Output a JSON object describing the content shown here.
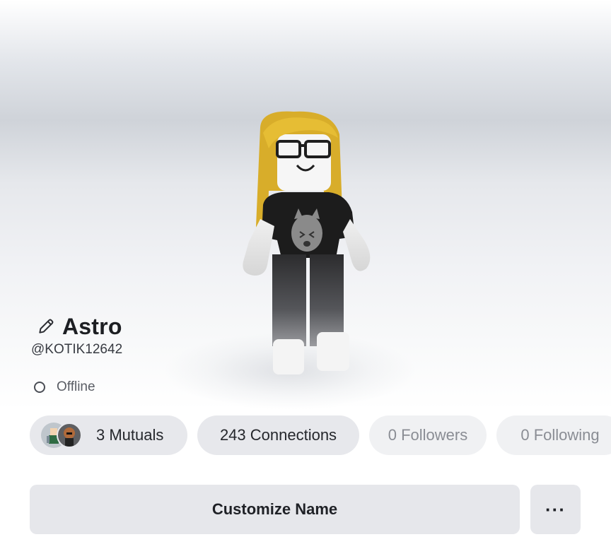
{
  "profile": {
    "display_name": "Astro",
    "username": "@KOTIK12642",
    "status": "Offline"
  },
  "stats": {
    "mutuals": "3 Mutuals",
    "connections": "243 Connections",
    "followers": "0 Followers",
    "following": "0 Following"
  },
  "actions": {
    "customize": "Customize Name",
    "more": "···"
  },
  "icons": {
    "edit": "pencil-icon",
    "status": "circle-outline-icon",
    "more": "ellipsis-icon"
  },
  "colors": {
    "pill_bg": "#e7e8ec",
    "pill_muted_bg": "#f0f1f3",
    "muted_text": "#8a8d94",
    "text": "#1d1f23"
  }
}
